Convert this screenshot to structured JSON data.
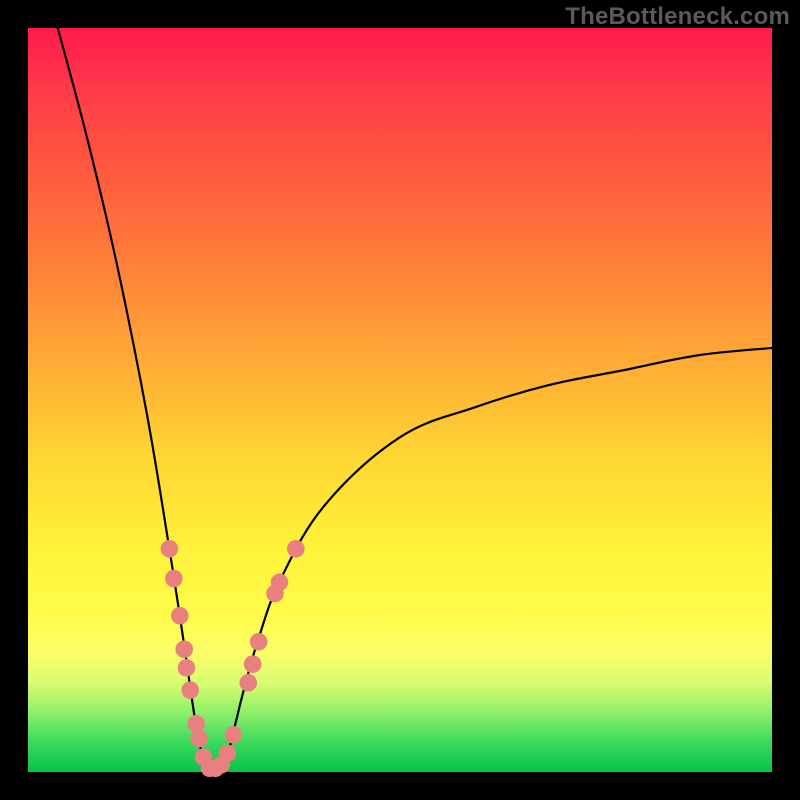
{
  "watermark": "TheBottleneck.com",
  "colors": {
    "frame_bg_top": "#ff1a4a",
    "frame_bg_bottom": "#08c24d",
    "curve": "#000000",
    "marker_fill": "#e98080",
    "marker_stroke": "#c85a5a",
    "page_bg": "#000000"
  },
  "chart_data": {
    "type": "line",
    "title": "",
    "xlabel": "",
    "ylabel": "",
    "xlim": [
      0,
      100
    ],
    "ylim": [
      0,
      100
    ],
    "curve_note": "V-shaped bottleneck curve: steep left branch dropping to ~0 near x≈24, shallower right branch rising to ~57 at x=100",
    "x": [
      4,
      8,
      12,
      16,
      19,
      21,
      22,
      23,
      24,
      25,
      26,
      27,
      28,
      29,
      31,
      34,
      40,
      50,
      60,
      70,
      80,
      90,
      100
    ],
    "values": [
      100,
      85,
      68,
      48,
      30,
      17,
      10,
      4,
      1,
      0,
      1,
      3,
      7,
      11,
      18,
      26,
      36,
      45,
      49,
      52,
      54,
      56,
      57
    ],
    "minimum_x": 24.5,
    "markers_note": "salmon beads clustered near the V bottom on both branches",
    "markers": [
      {
        "x": 19.0,
        "y": 30
      },
      {
        "x": 19.6,
        "y": 26
      },
      {
        "x": 20.4,
        "y": 21
      },
      {
        "x": 21.0,
        "y": 16.5
      },
      {
        "x": 21.3,
        "y": 14
      },
      {
        "x": 21.8,
        "y": 11
      },
      {
        "x": 22.6,
        "y": 6.5
      },
      {
        "x": 23.0,
        "y": 4.5
      },
      {
        "x": 23.6,
        "y": 2
      },
      {
        "x": 24.4,
        "y": 0.5
      },
      {
        "x": 25.2,
        "y": 0.5
      },
      {
        "x": 26.0,
        "y": 1
      },
      {
        "x": 26.8,
        "y": 2.5
      },
      {
        "x": 27.6,
        "y": 5
      },
      {
        "x": 29.6,
        "y": 12
      },
      {
        "x": 30.2,
        "y": 14.5
      },
      {
        "x": 31.0,
        "y": 17.5
      },
      {
        "x": 33.2,
        "y": 24
      },
      {
        "x": 33.8,
        "y": 25.5
      },
      {
        "x": 36.0,
        "y": 30
      }
    ]
  }
}
